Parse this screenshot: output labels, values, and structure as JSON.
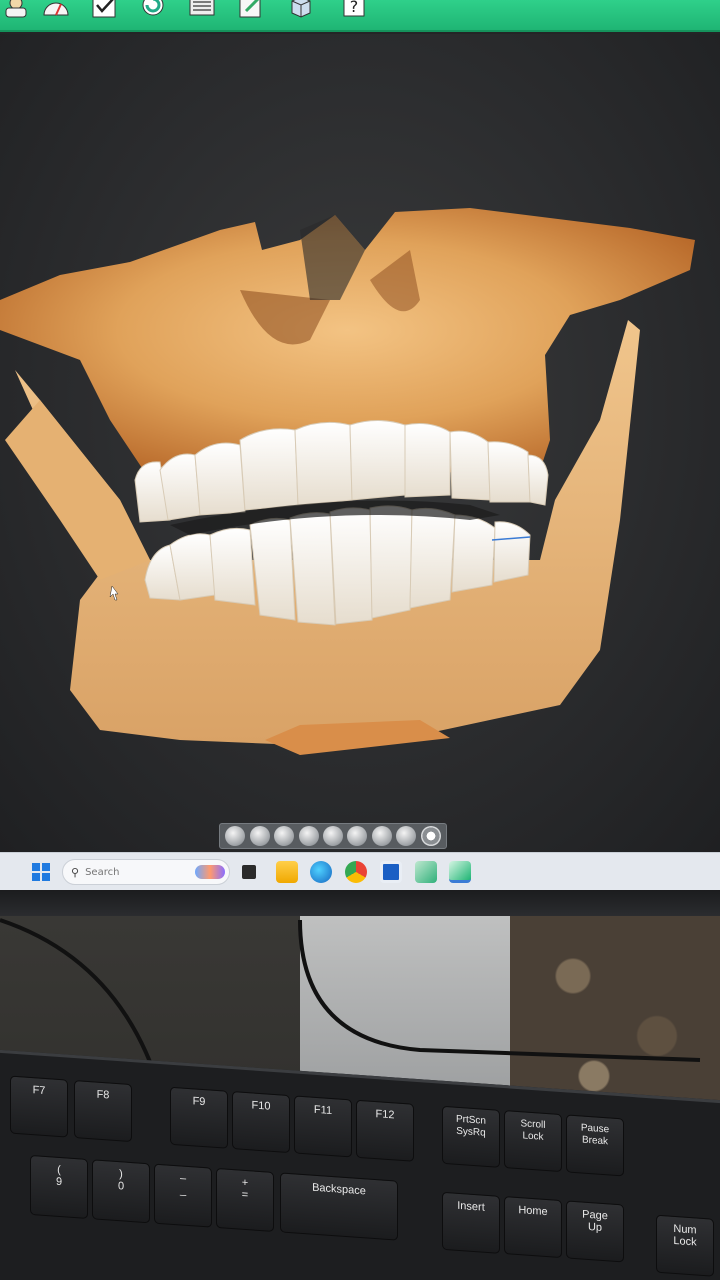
{
  "taskbar": {
    "search_placeholder": "Search"
  },
  "view_controls": {
    "buttons": [
      "view-front",
      "view-back",
      "view-left",
      "view-right",
      "view-top",
      "view-bottom",
      "view-iso-1",
      "view-iso-2",
      "view-rotate"
    ]
  },
  "keyboard": {
    "keys": {
      "f7": "F7",
      "f8": "F8",
      "f9": "F9",
      "f10": "F10",
      "f11": "F11",
      "f12": "F12",
      "prtscn": "PrtScn\nSysRq",
      "scroll": "Scroll\nLock",
      "pause": "Pause\nBreak",
      "nine": "(\n9",
      "zero": ")\n0",
      "minus": "–\n_",
      "plus": "+\n=",
      "backspace": "Backspace",
      "insert": "Insert",
      "home": "Home",
      "pageup": "Page\nUp",
      "numlock": "Num\nLock"
    }
  },
  "colors": {
    "toolbar": "#1fb574",
    "bone": "#e0a25a",
    "teeth": "#f4f1ea"
  }
}
